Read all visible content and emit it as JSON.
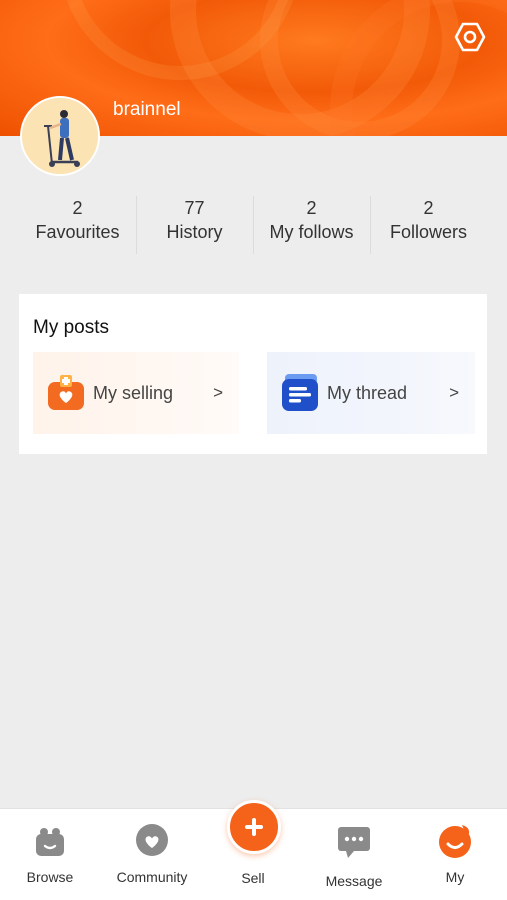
{
  "profile": {
    "username": "brainnel"
  },
  "stats": [
    {
      "value": "2",
      "label": "Favourites"
    },
    {
      "value": "77",
      "label": "History"
    },
    {
      "value": "2",
      "label": "My follows"
    },
    {
      "value": "2",
      "label": "Followers"
    }
  ],
  "posts": {
    "title": "My posts",
    "selling_label": "My selling",
    "thread_label": "My thread",
    "chevron": ">"
  },
  "tabbar": {
    "browse": "Browse",
    "community": "Community",
    "sell": "Sell",
    "message": "Message",
    "my": "My"
  },
  "colors": {
    "accent": "#f5621a",
    "header": "#f25a08",
    "background": "#ededed"
  },
  "icons": {
    "settings": "hexagon-gear-icon",
    "selling": "orange-bag-heart-icon",
    "thread": "blue-document-icon"
  }
}
